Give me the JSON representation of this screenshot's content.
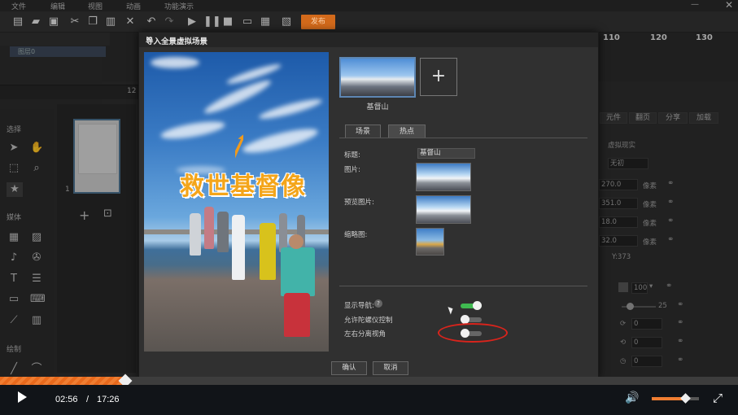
{
  "menu": [
    "文件",
    "编辑",
    "视图",
    "动画",
    "功能演示"
  ],
  "toolbar": {
    "publish_label": "发布"
  },
  "layers": {
    "row_label": "图层0"
  },
  "timeline": {
    "ruler_labels": [
      "110",
      "120",
      "130"
    ],
    "left_tick": "12"
  },
  "left_panel": {
    "select_title": "选择",
    "media_title": "媒体",
    "draw_title": "绘制",
    "scene_index": "1"
  },
  "right_panel": {
    "tabs": [
      "元件",
      "翻页",
      "分享",
      "加载"
    ],
    "label_vr": "虚拟现实",
    "placeholder_field": "无初",
    "fields": [
      "270.0",
      "351.0",
      "18.0",
      "32.0"
    ],
    "unit": "像素",
    "y_readout": "Y:373",
    "opacity": "100",
    "slider_value": "25",
    "zero_fields": [
      "0",
      "0",
      "0"
    ]
  },
  "dialog": {
    "title": "导入全景虚拟场景",
    "preview_caption": "救世基督像",
    "scene_label": "基督山",
    "add_symbol": "+",
    "tabs": {
      "scene": "场景",
      "hotspot": "热点"
    },
    "labels": {
      "title": "标题:",
      "image": "图片:",
      "preview_image": "预览图片:",
      "thumbnail": "缩略图:",
      "show_nav": "显示导航:",
      "gyro": "允许陀螺仪控制",
      "split_view": "左右分离视角"
    },
    "title_value": "基督山",
    "help": "?",
    "toggles": {
      "show_nav": true,
      "gyro": false,
      "split_view": false
    },
    "ok": "确认",
    "cancel": "取消",
    "accent": "#3fb950"
  },
  "player": {
    "current_time": "02:56",
    "separator": "/",
    "total_time": "17:26",
    "progress": 0.168,
    "volume": 0.7,
    "accent": "#f07e32"
  }
}
